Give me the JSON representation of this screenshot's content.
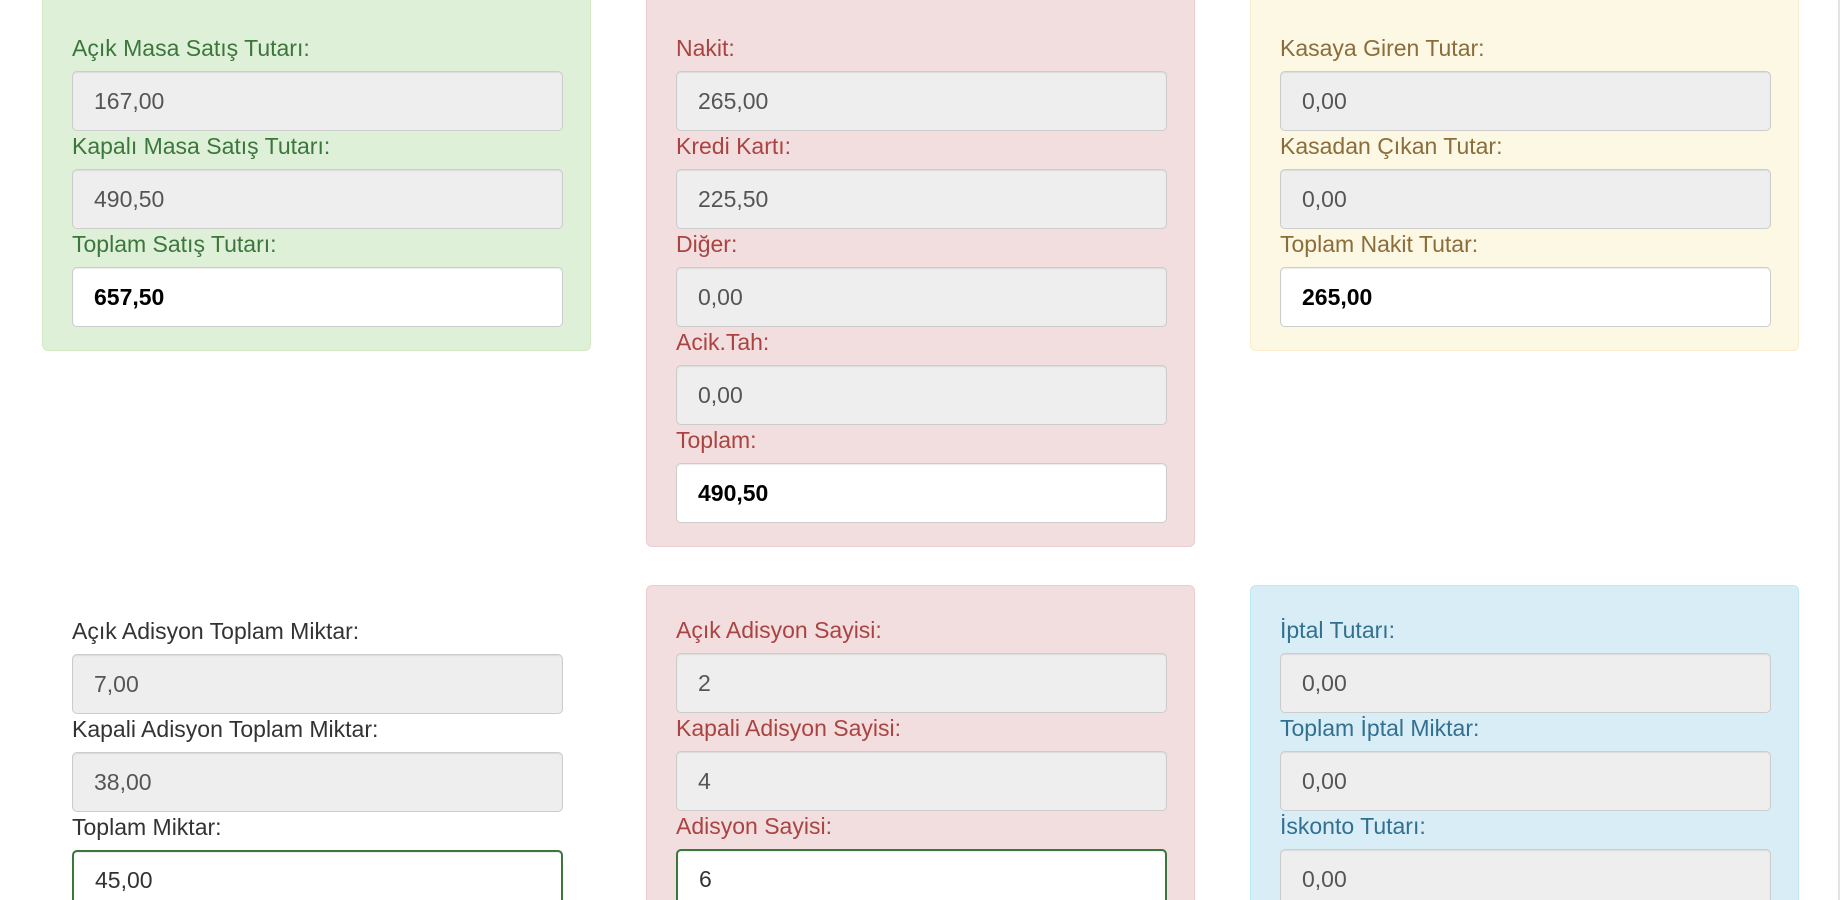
{
  "panels": {
    "sales": {
      "open_table_sales_label": "Açık Masa Satış Tutarı:",
      "open_table_sales_value": "167,00",
      "closed_table_sales_label": "Kapalı Masa Satış Tutarı:",
      "closed_table_sales_value": "490,50",
      "total_sales_label": "Toplam Satış Tutarı:",
      "total_sales_value": "657,50"
    },
    "payments": {
      "cash_label": "Nakit:",
      "cash_value": "265,00",
      "credit_card_label": "Kredi Kartı:",
      "credit_card_value": "225,50",
      "other_label": "Diğer:",
      "other_value": "0,00",
      "open_account_label": "Acik.Tah:",
      "open_account_value": "0,00",
      "total_label": "Toplam:",
      "total_value": "490,50"
    },
    "cash_register": {
      "cash_in_label": "Kasaya Giren Tutar:",
      "cash_in_value": "0,00",
      "cash_out_label": "Kasadan Çıkan Tutar:",
      "cash_out_value": "0,00",
      "total_cash_label": "Toplam Nakit Tutar:",
      "total_cash_value": "265,00"
    },
    "quantities": {
      "open_ticket_qty_label": "Açık Adisyon Toplam Miktar:",
      "open_ticket_qty_value": "7,00",
      "closed_ticket_qty_label": "Kapali Adisyon Toplam Miktar:",
      "closed_ticket_qty_value": "38,00",
      "total_qty_label": "Toplam Miktar:",
      "total_qty_value": "45,00"
    },
    "ticket_counts": {
      "open_ticket_count_label": "Açık Adisyon Sayisi:",
      "open_ticket_count_value": "2",
      "closed_ticket_count_label": "Kapali Adisyon Sayisi:",
      "closed_ticket_count_value": "4",
      "ticket_count_label": "Adisyon Sayisi:",
      "ticket_count_value": "6"
    },
    "cancellations": {
      "cancel_amount_label": "İptal Tutarı:",
      "cancel_amount_value": "0,00",
      "total_cancel_qty_label": "Toplam İptal Miktar:",
      "total_cancel_qty_value": "0,00",
      "discount_amount_label": "İskonto Tutarı:",
      "discount_amount_value": "0,00"
    }
  },
  "colors": {
    "green_panel": "#dff0d8",
    "red_panel": "#f2dede",
    "yellow_panel": "#fcf8e3",
    "blue_panel": "#d9edf7",
    "readonly_field": "#eeeeee",
    "focus_border": "#3c763d"
  }
}
